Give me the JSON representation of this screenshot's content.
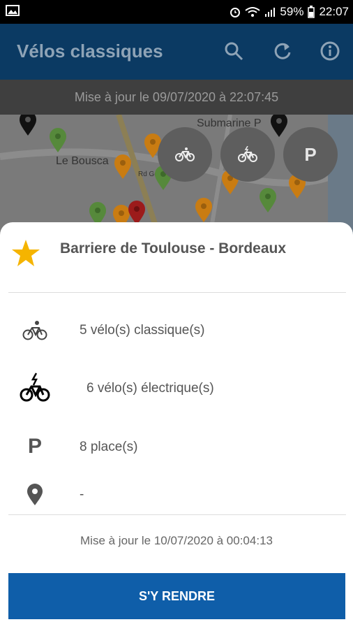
{
  "status_bar": {
    "battery": "59%",
    "time": "22:07"
  },
  "app_bar": {
    "title": "Vélos classiques"
  },
  "update_bar": {
    "text": "Mise à jour le 09/07/2020 à 22:07:45"
  },
  "map": {
    "labels": {
      "bouscat": "Le Bousca",
      "submarine": "Submarine P",
      "rd": "Rd Go"
    }
  },
  "filters": {
    "parking_label": "P"
  },
  "station": {
    "name": "Barriere de Toulouse - Bordeaux",
    "classic_bikes": "5 vélo(s) classique(s)",
    "electric_bikes": "6 vélo(s) électrique(s)",
    "places": "8 place(s)",
    "parking_glyph": "P",
    "address": "-",
    "updated": "Mise à jour le 10/07/2020 à 00:04:13"
  },
  "actions": {
    "go_label": "S'Y RENDRE"
  },
  "colors": {
    "app_bar": "#0b3a63",
    "button": "#0f5ea9",
    "star": "#f5b400"
  }
}
